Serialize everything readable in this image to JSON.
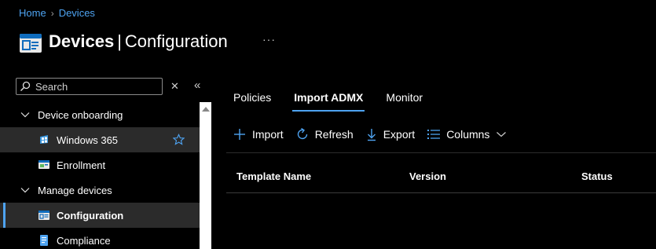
{
  "breadcrumb": {
    "home": "Home",
    "devices": "Devices"
  },
  "header": {
    "title_bold": "Devices",
    "separator": "|",
    "title_rest": "Configuration",
    "more": "···"
  },
  "sidebar": {
    "search_placeholder": "Search",
    "items": [
      {
        "type": "group",
        "label": "Device onboarding"
      },
      {
        "type": "child",
        "label": "Windows 365",
        "icon": "windows-365-icon",
        "favorite": true
      },
      {
        "type": "child",
        "label": "Enrollment",
        "icon": "enrollment-icon"
      },
      {
        "type": "group",
        "label": "Manage devices"
      },
      {
        "type": "child",
        "label": "Configuration",
        "icon": "configuration-icon",
        "selected": true
      },
      {
        "type": "child",
        "label": "Compliance",
        "icon": "compliance-icon"
      }
    ]
  },
  "tabs": [
    {
      "label": "Policies",
      "active": false
    },
    {
      "label": "Import ADMX",
      "active": true
    },
    {
      "label": "Monitor",
      "active": false
    }
  ],
  "toolbar": {
    "import": "Import",
    "refresh": "Refresh",
    "export": "Export",
    "columns": "Columns"
  },
  "table": {
    "columns": [
      "Template Name",
      "Version",
      "Status"
    ]
  },
  "colors": {
    "accent": "#4ea3f1",
    "background": "#000000",
    "hover": "#2b2b2b"
  }
}
